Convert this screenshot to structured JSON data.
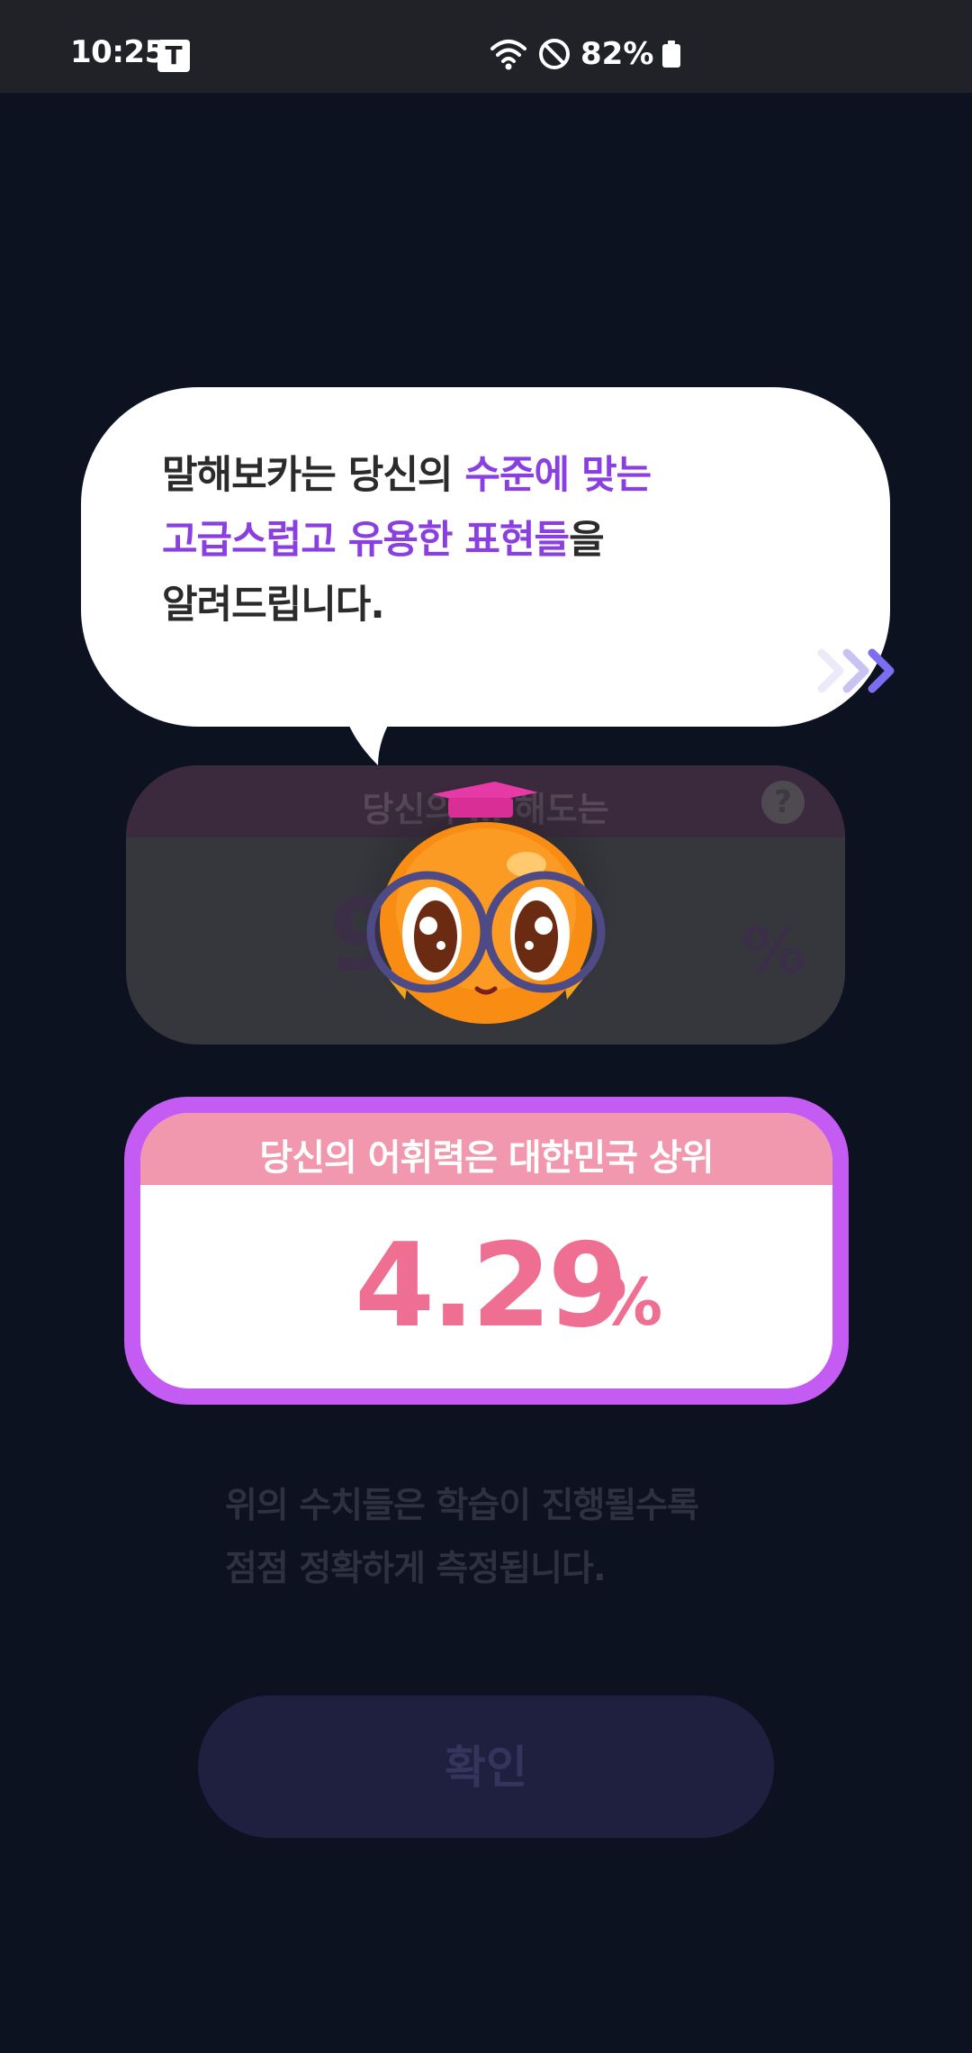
{
  "status_bar": {
    "time": "10:25",
    "carrier_icon_letter": "T",
    "battery_percent": "82%",
    "icons": [
      "wifi-icon",
      "do-not-disturb-icon",
      "battery-icon"
    ]
  },
  "speech_bubble": {
    "line1_normal": "말해보카는 당신의 ",
    "line1_highlight": "수준에 맞는",
    "line2_highlight": "고급스럽고 유용한 표현들",
    "line2_normal": "을",
    "line3_normal": "알려드립니다.",
    "highlight_color": "#8a3fe0"
  },
  "understanding_card": {
    "title": "당신의 … 해도는",
    "help_label": "?",
    "percent_sign": "%"
  },
  "rank_card": {
    "title": "당신의 어휘력은 대한민국 상위",
    "value": "4.29",
    "percent_sign": "%",
    "border_color": "#c45bf2",
    "header_color": "#f198ae",
    "value_color": "#ef6f93"
  },
  "footnote": {
    "line1": "위의 수치들은 학습이 진행될수록",
    "line2": "점점 정확하게 측정됩니다."
  },
  "confirm_button": {
    "label": "확인"
  }
}
